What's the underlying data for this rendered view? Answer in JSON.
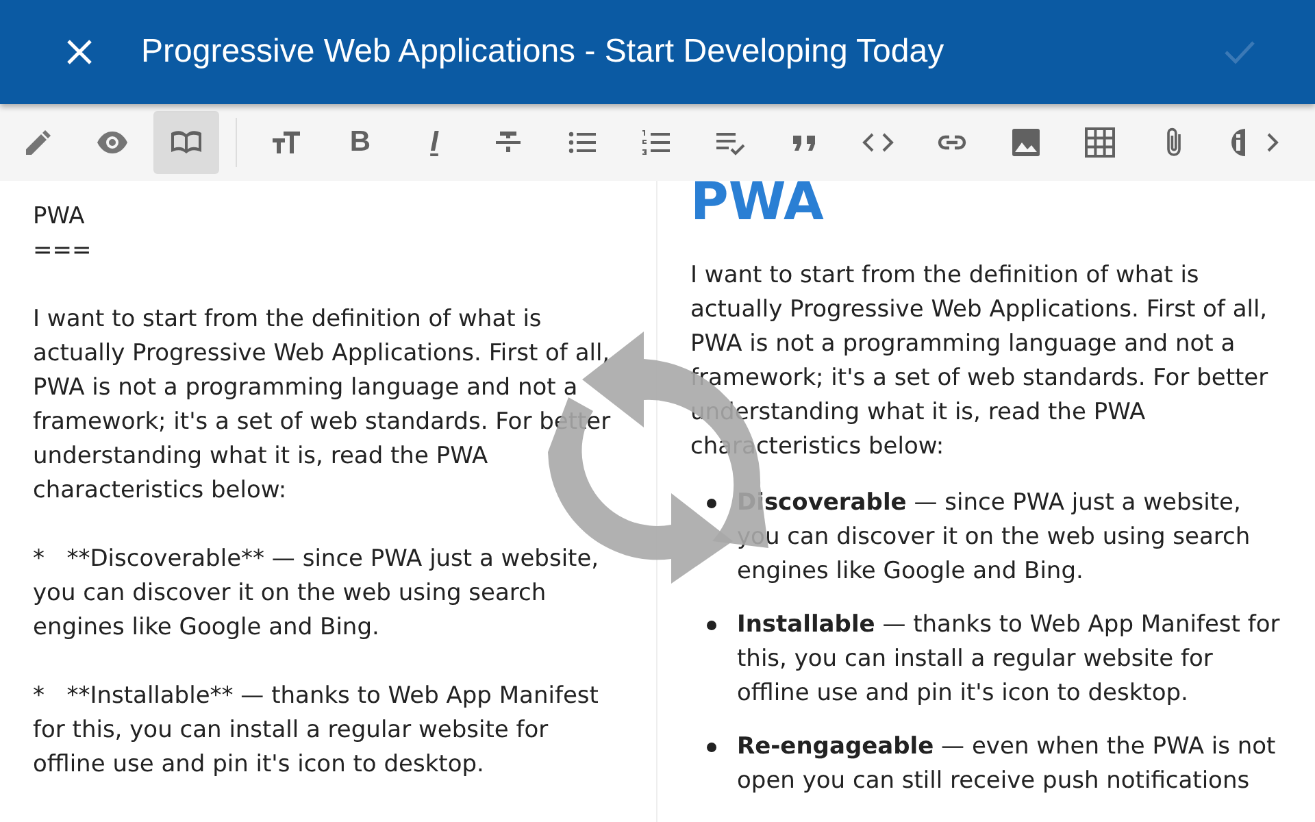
{
  "header": {
    "title": "Progressive Web Applications - Start Developing Today",
    "confirm_disabled": true
  },
  "toolbar": [
    {
      "kind": "pencil",
      "selected": false
    },
    {
      "kind": "eye",
      "selected": false
    },
    {
      "kind": "book",
      "selected": true
    },
    {
      "kind": "divider"
    },
    {
      "kind": "text-size",
      "selected": false
    },
    {
      "kind": "bold",
      "label": "B",
      "selected": false
    },
    {
      "kind": "italic",
      "label": "I",
      "selected": false
    },
    {
      "kind": "strike",
      "selected": false
    },
    {
      "kind": "bullets",
      "selected": false
    },
    {
      "kind": "numbers",
      "selected": false
    },
    {
      "kind": "checklist",
      "selected": false
    },
    {
      "kind": "quote",
      "selected": false
    },
    {
      "kind": "code",
      "selected": false
    },
    {
      "kind": "link",
      "selected": false
    },
    {
      "kind": "image",
      "selected": false
    },
    {
      "kind": "table",
      "selected": false
    },
    {
      "kind": "clip",
      "selected": false
    },
    {
      "kind": "info",
      "selected": false
    },
    {
      "kind": "more",
      "selected": false
    }
  ],
  "source": [
    "PWA\n===",
    "I want to start from the definition of what is actually Progressive Web Applications. First of all, PWA is not a programming language and not a framework; it's a set of web standards. For better understanding what it is, read the PWA characteristics below:",
    "*   **Discoverable** — since PWA just a website, you can discover it on the web using search engines like Google and Bing.",
    "*   **Installable** — thanks to Web App Manifest for this, you can install a regular website for offline use and pin it's icon to desktop."
  ],
  "preview": {
    "heading": "PWA",
    "paragraph": "I want to start from the definition of what is actually Progressive Web Applications. First of all, PWA is not a programming language and not a framework; it's a set of web standards. For better understanding what it is, read the PWA characteristics below:",
    "items": [
      "**Discoverable** — since PWA just a website, you can discover it on the web using search engines like Google and Bing.",
      "**Installable** — thanks to Web App Manifest for this, you can install a regular website for offline use and pin it's icon to desktop.",
      "**Re-engageable** — even when the PWA is not open you can still receive push notifications"
    ]
  }
}
